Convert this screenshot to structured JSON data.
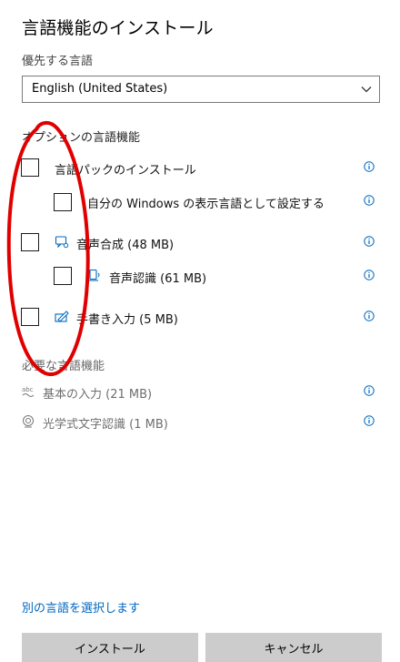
{
  "window": {
    "title": "言語機能のインストール"
  },
  "preferred": {
    "label": "優先する言語",
    "selected": "English (United States)"
  },
  "optional": {
    "heading": "オプションの言語機能",
    "items": [
      {
        "label": "言語パックのインストール",
        "checked": false,
        "icon": ""
      },
      {
        "label": "自分の Windows の表示言語として設定する",
        "checked": false,
        "icon": ""
      },
      {
        "label": "音声合成 (48 MB)",
        "checked": false,
        "icon": "speech-synthesis-icon"
      },
      {
        "label": "音声認識 (61 MB)",
        "checked": false,
        "icon": "speech-recognition-icon"
      },
      {
        "label": "手書き入力 (5 MB)",
        "checked": false,
        "icon": "handwriting-icon"
      }
    ]
  },
  "required": {
    "heading": "必要な言語機能",
    "items": [
      {
        "label": "基本の入力 (21 MB)",
        "icon": "basic-typing-icon"
      },
      {
        "label": "光学式文字認識 (1 MB)",
        "icon": "ocr-icon"
      }
    ]
  },
  "footer": {
    "link": "別の言語を選択します",
    "install_label": "インストール",
    "cancel_label": "キャンセル"
  },
  "colors": {
    "accent": "#0067c0",
    "button_bg": "#cccccc",
    "annotation": "#e00000"
  }
}
